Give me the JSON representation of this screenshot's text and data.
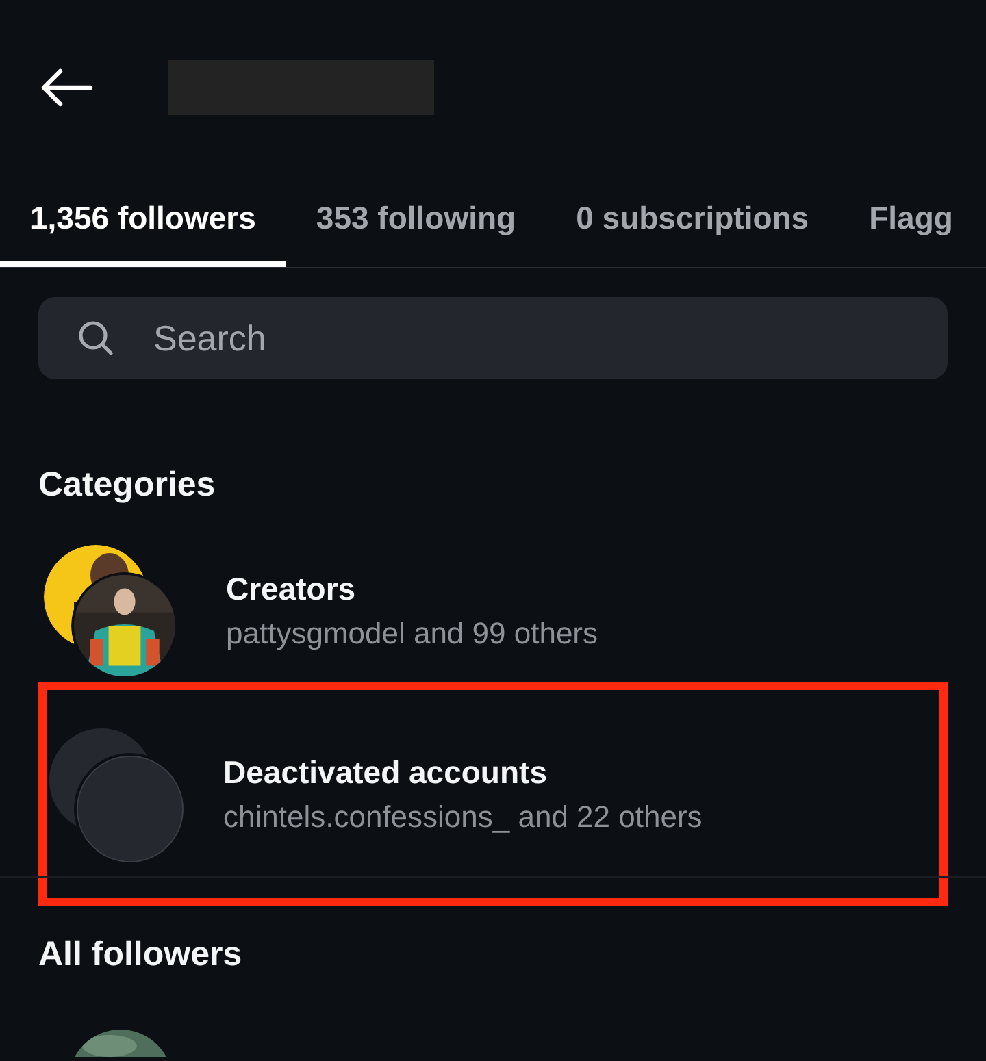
{
  "header": {
    "title_redacted": true
  },
  "tabs": [
    {
      "label": "1,356 followers",
      "selected": true
    },
    {
      "label": "353 following",
      "selected": false
    },
    {
      "label": "0 subscriptions",
      "selected": false
    },
    {
      "label": "Flagg",
      "selected": false
    }
  ],
  "search": {
    "placeholder": "Search"
  },
  "categories": {
    "heading": "Categories",
    "items": [
      {
        "title": "Creators",
        "subtitle": "pattysgmodel and 99 others",
        "highlighted": false
      },
      {
        "title": "Deactivated accounts",
        "subtitle": "chintels.confessions_ and 22 others",
        "kind": "blank",
        "highlighted": true
      }
    ]
  },
  "all_followers": {
    "heading": "All followers"
  }
}
